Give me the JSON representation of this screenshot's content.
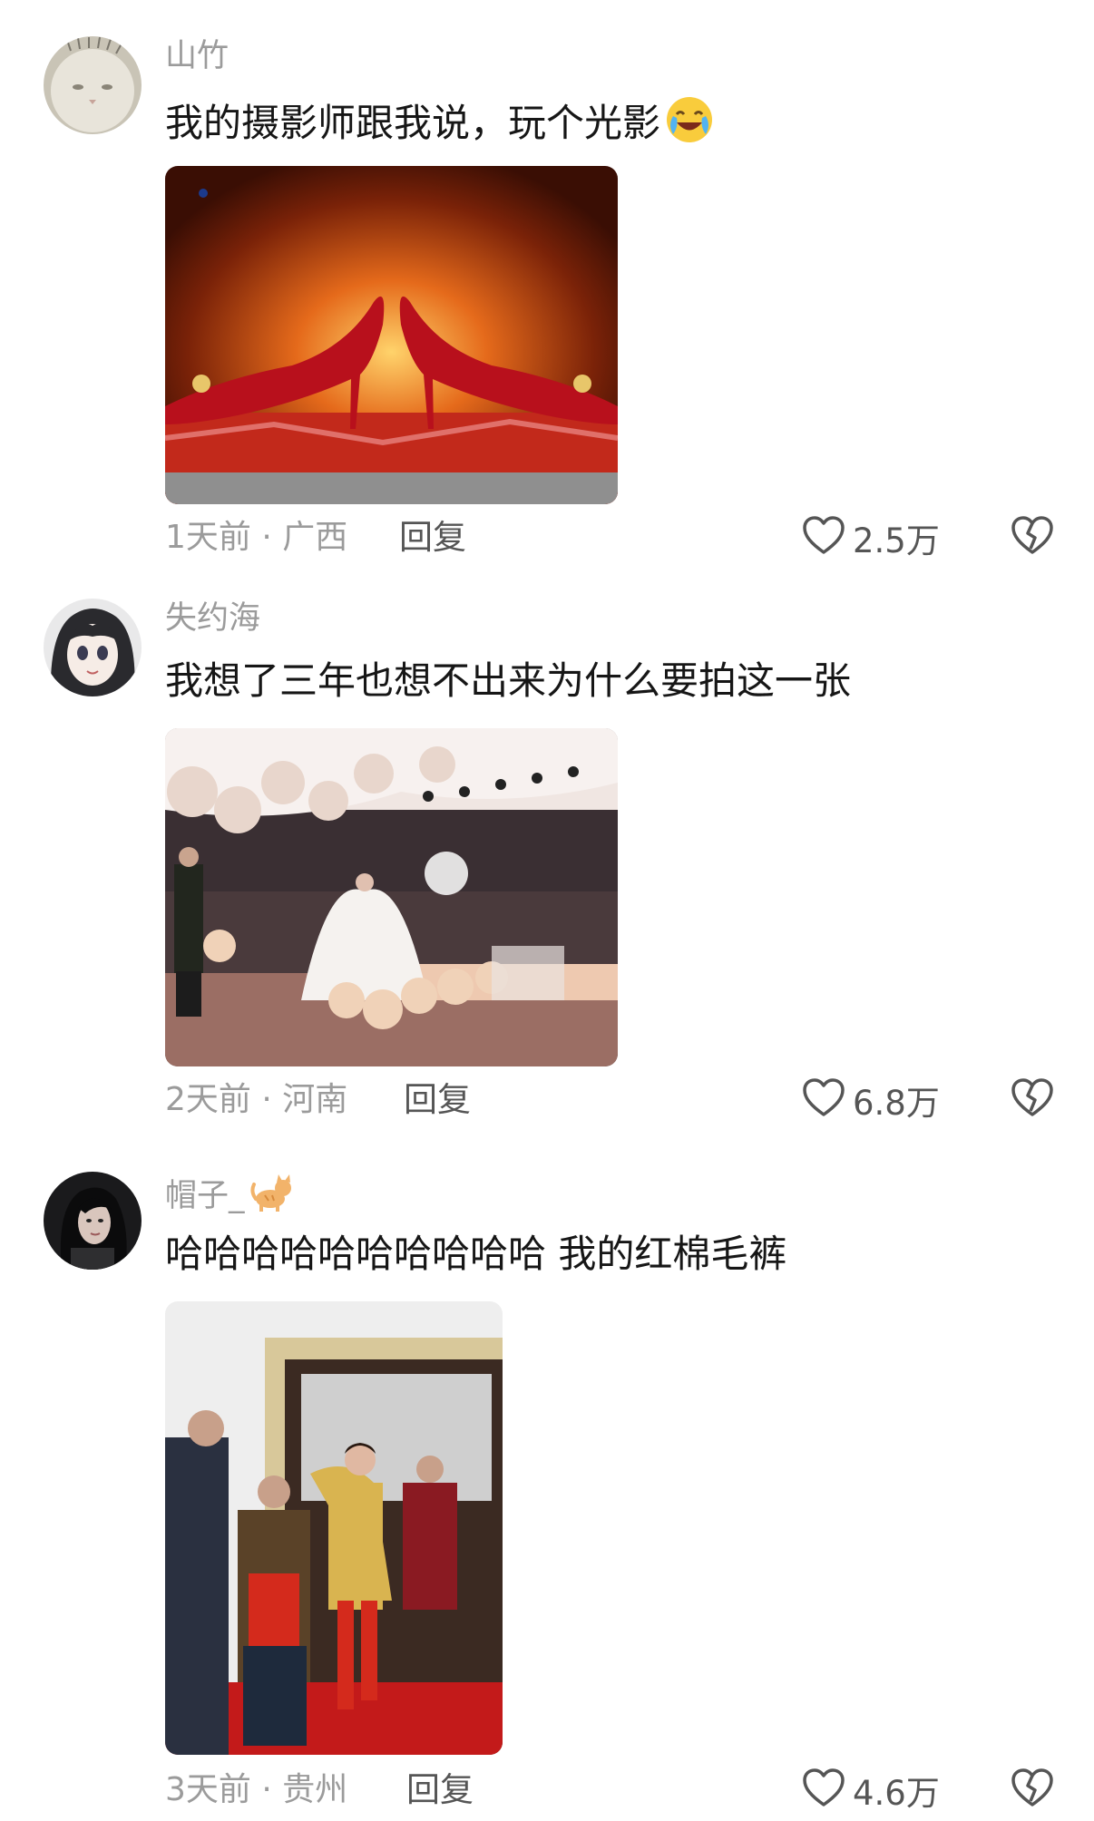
{
  "comments": [
    {
      "username": "山竹",
      "text": "我的摄影师跟我说，玩个光影",
      "emoji": "crying-laughing-emoji",
      "time_location": "1天前 · 广西",
      "reply_label": "回复",
      "likes": "2.5万",
      "avatar": "white-cat-avatar",
      "image": "red-high-heels-photo"
    },
    {
      "username": "失约海",
      "text": "我想了三年也想不出来为什么要拍这一张",
      "time_location": "2天前 · 河南",
      "reply_label": "回复",
      "likes": "6.8万",
      "avatar": "anime-girl-avatar",
      "image": "wedding-hall-photo"
    },
    {
      "username": "帽子_",
      "username_emoji": "cat-emoji",
      "text": "哈哈哈哈哈哈哈哈哈哈 我的红棉毛裤",
      "time_location": "3天前 · 贵州",
      "reply_label": "回复",
      "likes": "4.6万",
      "avatar": "dark-haired-woman-avatar",
      "image": "bride-carried-doorway-photo"
    }
  ],
  "colors": {
    "text": "#161616",
    "muted": "#9b9b9b",
    "action": "#555555"
  }
}
